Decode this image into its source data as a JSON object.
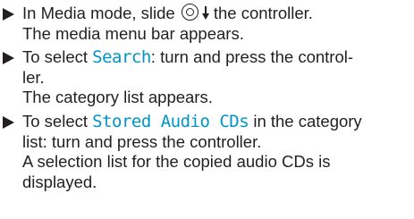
{
  "instructions": {
    "steps": [
      {
        "action_before_icon": "In Media mode, slide",
        "icon": "controller-slide-down-icon",
        "action_after_icon": "the controller.",
        "result": "The media menu bar appears."
      },
      {
        "action_before_term": "To select",
        "term": "Search",
        "action_after_term_line1": ": turn and press the control-",
        "action_line2": "ler.",
        "result": "The category list appears."
      },
      {
        "action_before_term": "To select",
        "term": "Stored Audio CDs",
        "action_after_term_line1": "in the category",
        "action_line2": "list: turn and press the controller.",
        "result_line1": "A selection list for the copied audio CDs is",
        "result_line2": "displayed."
      }
    ]
  },
  "colors": {
    "text": "#231f20",
    "menu_term": "#0095c6"
  }
}
